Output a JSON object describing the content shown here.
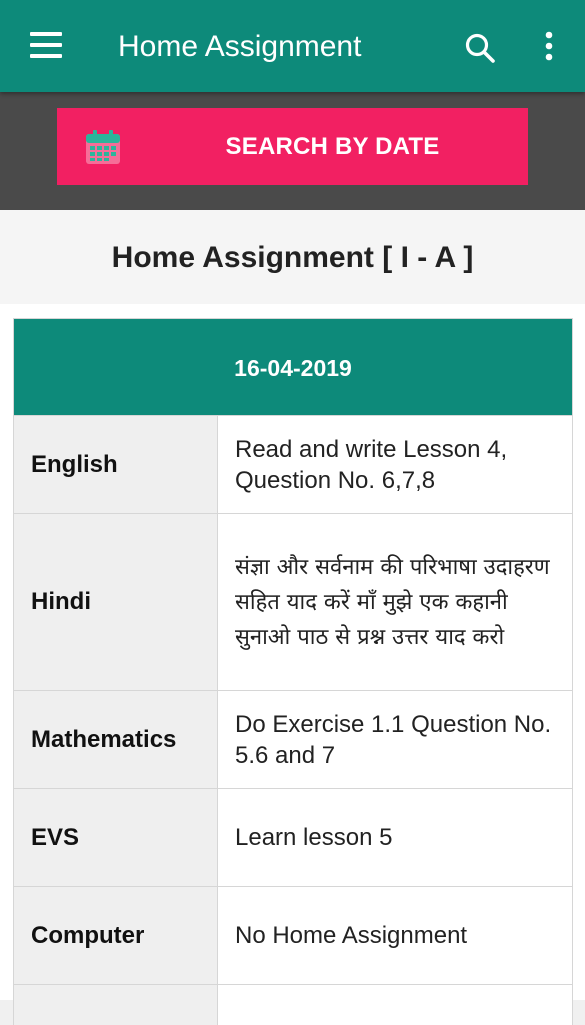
{
  "appbar": {
    "title": "Home Assignment",
    "menu_icon": "hamburger-menu-icon",
    "search_icon": "search-icon",
    "more_icon": "more-vertical-icon"
  },
  "search_by_date": {
    "label": "SEARCH BY DATE",
    "icon": "calendar-icon"
  },
  "class_heading": "Home Assignment [ I - A ]",
  "assignment_table": {
    "date": "16-04-2019",
    "rows": [
      {
        "subject": "English",
        "task": "Read and write Lesson 4, Question No. 6,7,8"
      },
      {
        "subject": "Hindi",
        "task": "संज्ञा और सर्वनाम की परिभाषा उदाहरण सहित याद करें माँ मुझे एक कहानी सुनाओ पाठ से प्रश्न उत्तर याद करो"
      },
      {
        "subject": "Mathematics",
        "task": "Do Exercise 1.1 Question No. 5.6 and 7"
      },
      {
        "subject": "EVS",
        "task": "Learn lesson 5"
      },
      {
        "subject": "Computer",
        "task": "No Home Assignment"
      }
    ]
  },
  "colors": {
    "primary": "#0d8a7a",
    "accent": "#f22062",
    "strip": "#4a4a4a"
  }
}
